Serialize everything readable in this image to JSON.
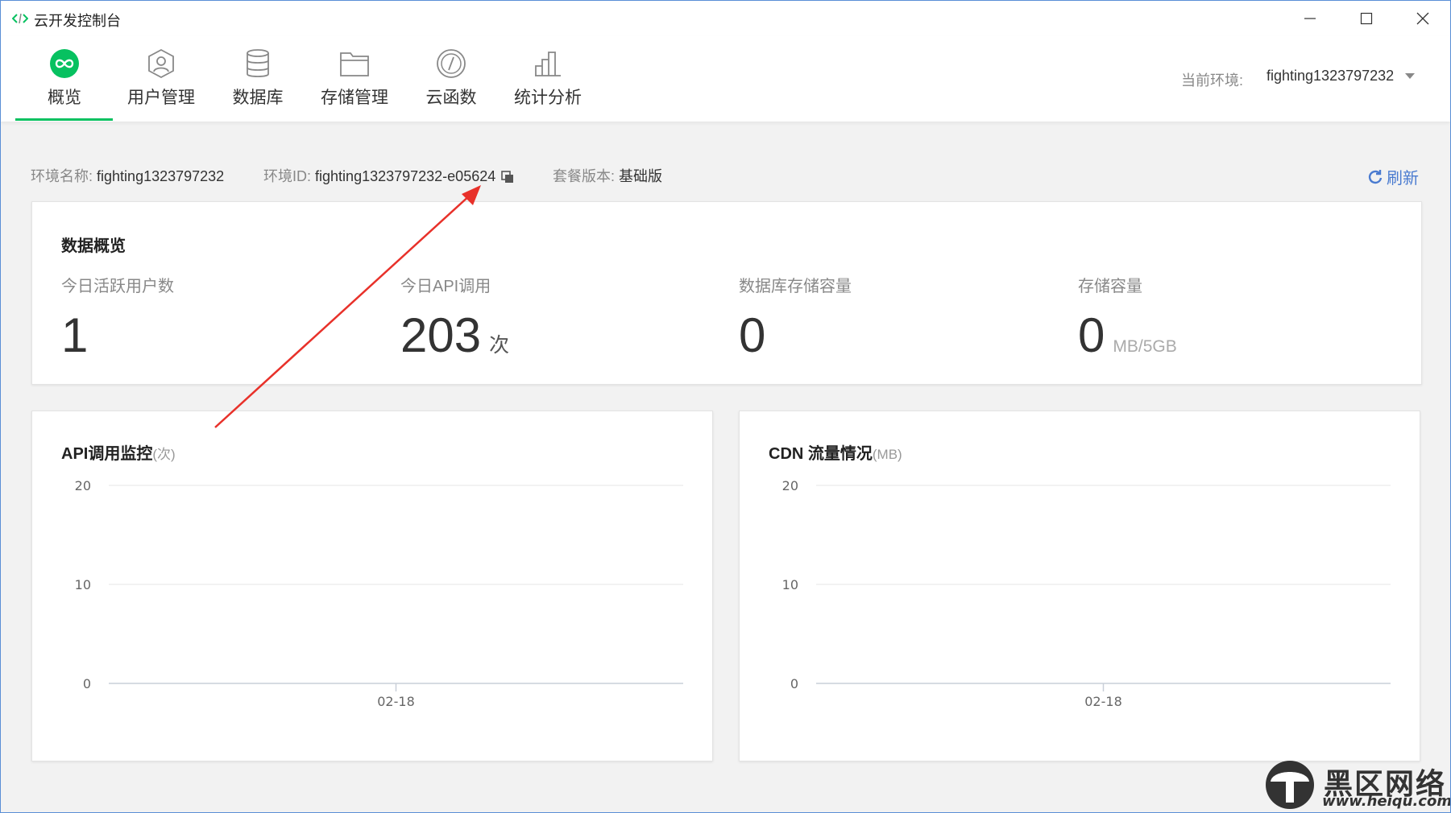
{
  "window": {
    "title": "云开发控制台"
  },
  "nav": {
    "items": [
      {
        "label": "概览",
        "icon": "overview-infinity-icon",
        "active": true
      },
      {
        "label": "用户管理",
        "icon": "user-icon",
        "active": false
      },
      {
        "label": "数据库",
        "icon": "database-icon",
        "active": false
      },
      {
        "label": "存储管理",
        "icon": "folder-icon",
        "active": false
      },
      {
        "label": "云函数",
        "icon": "function-icon",
        "active": false
      },
      {
        "label": "统计分析",
        "icon": "stats-icon",
        "active": false
      }
    ],
    "env_label": "当前环境:",
    "env_value": "fighting1323797232"
  },
  "info": {
    "env_name_key": "环境名称:",
    "env_name_val": "fighting1323797232",
    "env_id_key": "环境ID:",
    "env_id_val": "fighting1323797232-e05624",
    "plan_key": "套餐版本:",
    "plan_val": "基础版",
    "refresh_label": "刷新"
  },
  "overview": {
    "title": "数据概览",
    "stats": [
      {
        "label": "今日活跃用户数",
        "value": "1",
        "unit": ""
      },
      {
        "label": "今日API调用",
        "value": "203",
        "unit": "次"
      },
      {
        "label": "数据库存储容量",
        "value": "0",
        "unit": ""
      },
      {
        "label": "存储容量",
        "value": "0",
        "unit": "MB/5GB"
      }
    ]
  },
  "charts": {
    "api": {
      "title": "API调用监控",
      "unit": "(次)"
    },
    "cdn": {
      "title": "CDN 流量情况",
      "unit": "(MB)"
    }
  },
  "chart_data": [
    {
      "type": "line",
      "title": "API调用监控(次)",
      "x": [
        "02-18"
      ],
      "series": [
        {
          "values": [
            0
          ]
        }
      ],
      "yticks": [
        "20",
        "10",
        "0"
      ],
      "ylim": [
        0,
        20
      ],
      "grid": true
    },
    {
      "type": "line",
      "title": "CDN 流量情况(MB)",
      "x": [
        "02-18"
      ],
      "series": [
        {
          "values": [
            0
          ]
        }
      ],
      "yticks": [
        "20",
        "10",
        "0"
      ],
      "ylim": [
        0,
        20
      ],
      "grid": true
    }
  ],
  "colors": {
    "accent": "#07c160",
    "link": "#4a7bd0",
    "annotation_arrow": "#e8312a"
  },
  "watermark": {
    "text": "黑区网络",
    "url": "www.heiqu.com"
  }
}
